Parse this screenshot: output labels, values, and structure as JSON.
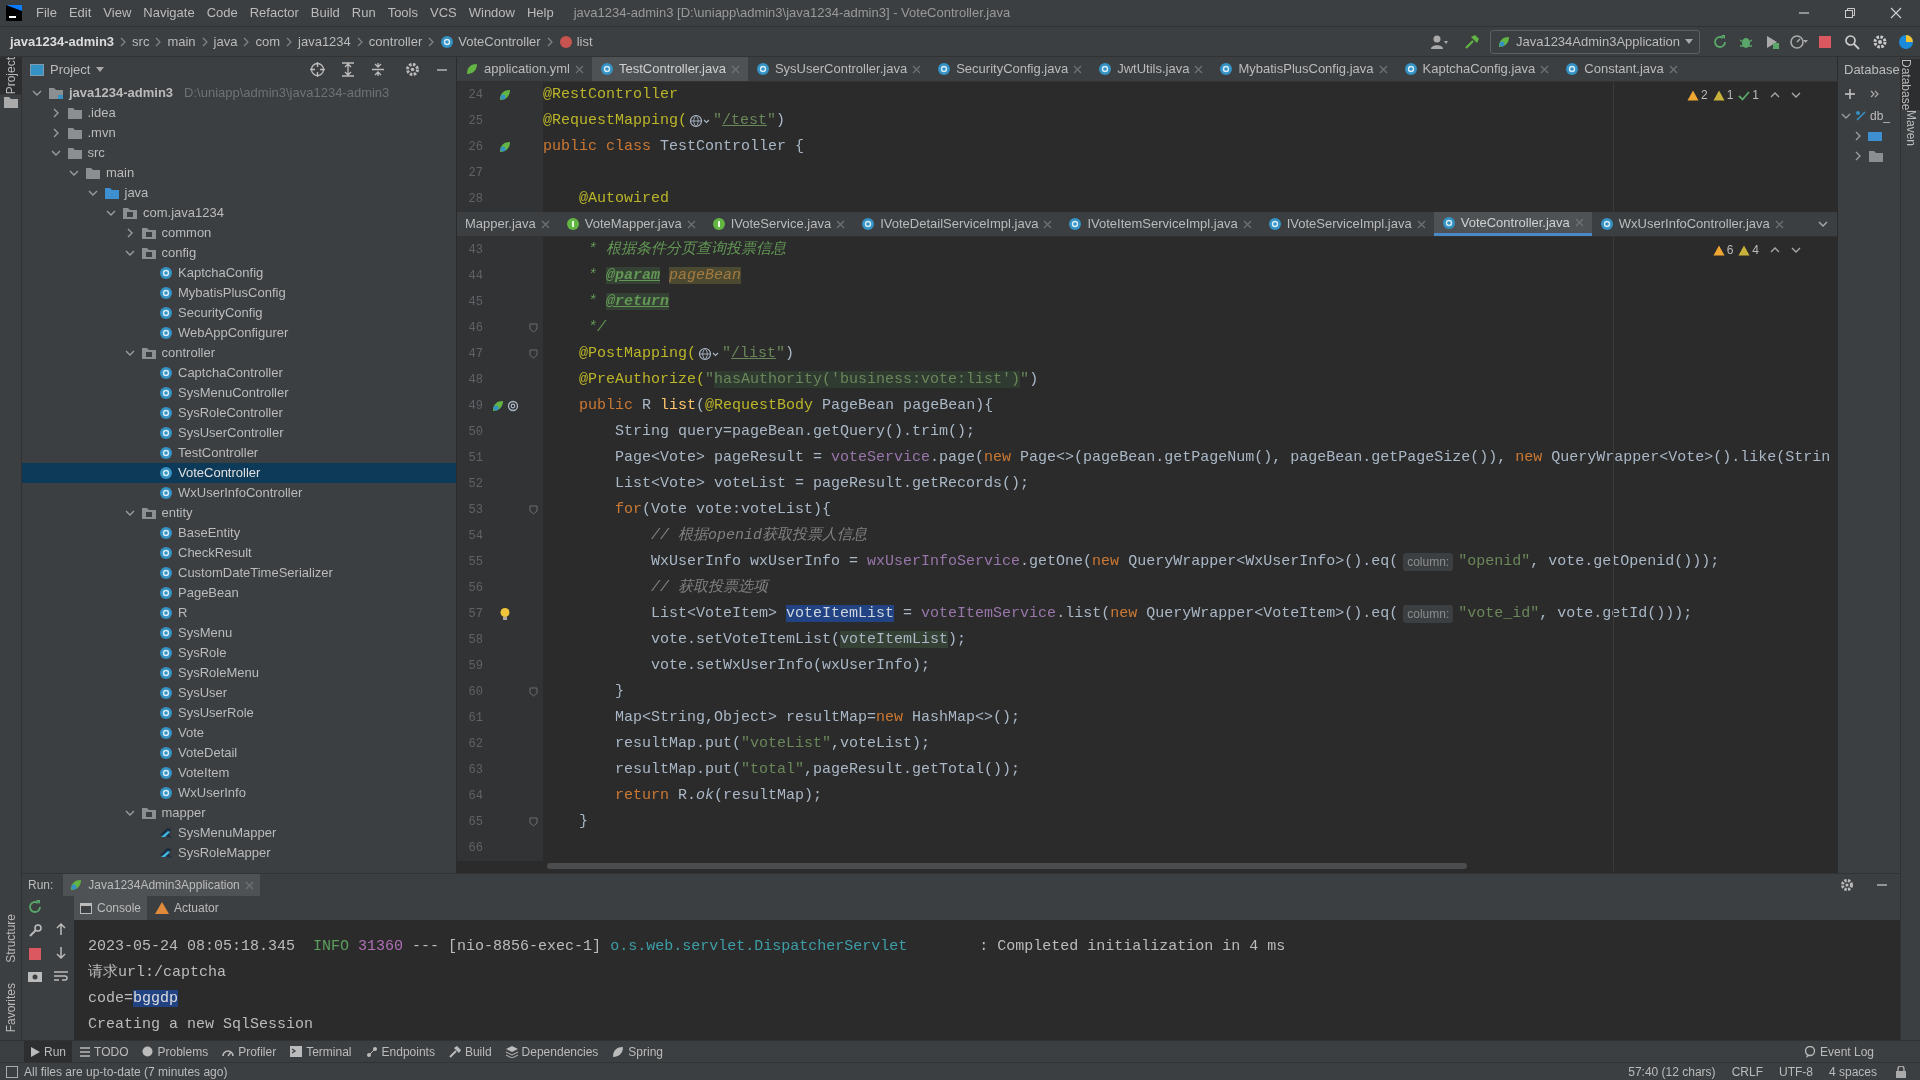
{
  "menu": [
    "File",
    "Edit",
    "View",
    "Navigate",
    "Code",
    "Refactor",
    "Build",
    "Run",
    "Tools",
    "VCS",
    "Window",
    "Help"
  ],
  "window_title": "java1234-admin3 [D:\\uniapp\\admin3\\java1234-admin3] - VoteController.java",
  "breadcrumb": [
    {
      "label": "java1234-admin3",
      "kind": "project"
    },
    {
      "label": "src",
      "kind": "folder"
    },
    {
      "label": "main",
      "kind": "folder"
    },
    {
      "label": "java",
      "kind": "folder"
    },
    {
      "label": "com",
      "kind": "folder"
    },
    {
      "label": "java1234",
      "kind": "folder"
    },
    {
      "label": "controller",
      "kind": "folder"
    },
    {
      "label": "VoteController",
      "kind": "class"
    },
    {
      "label": "list",
      "kind": "method"
    }
  ],
  "run_config": "Java1234Admin3Application",
  "project": {
    "title": "Project",
    "tree": [
      {
        "label": "java1234-admin3",
        "hint": "D:\\uniapp\\admin3\\java1234-admin3",
        "kind": "module",
        "expanded": true,
        "selected": false,
        "children": [
          {
            "label": ".idea",
            "kind": "folder",
            "expanded": false,
            "selected": false
          },
          {
            "label": ".mvn",
            "kind": "folder",
            "expanded": false,
            "selected": false
          },
          {
            "label": "src",
            "kind": "folder",
            "expanded": true,
            "selected": false,
            "children": [
              {
                "label": "main",
                "kind": "folder",
                "expanded": true,
                "selected": false,
                "children": [
                  {
                    "label": "java",
                    "kind": "source_root",
                    "expanded": true,
                    "selected": false,
                    "children": [
                      {
                        "label": "com.java1234",
                        "kind": "package",
                        "expanded": true,
                        "selected": false,
                        "children": [
                          {
                            "label": "common",
                            "kind": "package",
                            "expanded": false,
                            "selected": false
                          },
                          {
                            "label": "config",
                            "kind": "package",
                            "expanded": true,
                            "selected": false,
                            "children": [
                              {
                                "label": "KaptchaConfig",
                                "kind": "class",
                                "selected": false
                              },
                              {
                                "label": "MybatisPlusConfig",
                                "kind": "class",
                                "selected": false
                              },
                              {
                                "label": "SecurityConfig",
                                "kind": "class",
                                "selected": false
                              },
                              {
                                "label": "WebAppConfigurer",
                                "kind": "class",
                                "selected": false
                              }
                            ]
                          },
                          {
                            "label": "controller",
                            "kind": "package",
                            "expanded": true,
                            "selected": false,
                            "children": [
                              {
                                "label": "CaptchaController",
                                "kind": "class",
                                "selected": false
                              },
                              {
                                "label": "SysMenuController",
                                "kind": "class",
                                "selected": false
                              },
                              {
                                "label": "SysRoleController",
                                "kind": "class",
                                "selected": false
                              },
                              {
                                "label": "SysUserController",
                                "kind": "class",
                                "selected": false
                              },
                              {
                                "label": "TestController",
                                "kind": "class",
                                "selected": false
                              },
                              {
                                "label": "VoteController",
                                "kind": "class",
                                "selected": true
                              },
                              {
                                "label": "WxUserInfoController",
                                "kind": "class",
                                "selected": false
                              }
                            ]
                          },
                          {
                            "label": "entity",
                            "kind": "package",
                            "expanded": true,
                            "selected": false,
                            "children": [
                              {
                                "label": "BaseEntity",
                                "kind": "class",
                                "selected": false
                              },
                              {
                                "label": "CheckResult",
                                "kind": "class",
                                "selected": false
                              },
                              {
                                "label": "CustomDateTimeSerializer",
                                "kind": "class",
                                "selected": false
                              },
                              {
                                "label": "PageBean",
                                "kind": "class",
                                "selected": false
                              },
                              {
                                "label": "R",
                                "kind": "class",
                                "selected": false
                              },
                              {
                                "label": "SysMenu",
                                "kind": "class",
                                "selected": false
                              },
                              {
                                "label": "SysRole",
                                "kind": "class",
                                "selected": false
                              },
                              {
                                "label": "SysRoleMenu",
                                "kind": "class",
                                "selected": false
                              },
                              {
                                "label": "SysUser",
                                "kind": "class",
                                "selected": false
                              },
                              {
                                "label": "SysUserRole",
                                "kind": "class",
                                "selected": false
                              },
                              {
                                "label": "Vote",
                                "kind": "class",
                                "selected": false
                              },
                              {
                                "label": "VoteDetail",
                                "kind": "class",
                                "selected": false
                              },
                              {
                                "label": "VoteItem",
                                "kind": "class",
                                "selected": false
                              },
                              {
                                "label": "WxUserInfo",
                                "kind": "class",
                                "selected": false
                              }
                            ]
                          },
                          {
                            "label": "mapper",
                            "kind": "package",
                            "expanded": true,
                            "selected": false,
                            "children": [
                              {
                                "label": "SysMenuMapper",
                                "kind": "mapper",
                                "selected": false
                              },
                              {
                                "label": "SysRoleMapper",
                                "kind": "mapper",
                                "selected": false
                              }
                            ]
                          }
                        ]
                      }
                    ]
                  }
                ]
              }
            ]
          }
        ]
      }
    ]
  },
  "editor_top": {
    "focused": false,
    "tabs": [
      {
        "label": "application.yml",
        "kind": "yaml",
        "selected": false
      },
      {
        "label": "TestController.java",
        "kind": "class",
        "selected": true
      },
      {
        "label": "SysUserController.java",
        "kind": "class",
        "selected": false
      },
      {
        "label": "SecurityConfig.java",
        "kind": "class",
        "selected": false
      },
      {
        "label": "JwtUtils.java",
        "kind": "class",
        "selected": false
      },
      {
        "label": "MybatisPlusConfig.java",
        "kind": "class",
        "selected": false
      },
      {
        "label": "KaptchaConfig.java",
        "kind": "class",
        "selected": false
      },
      {
        "label": "Constant.java",
        "kind": "class",
        "selected": false
      }
    ],
    "inspections": [
      {
        "kind": "warning",
        "count": "2"
      },
      {
        "kind": "weak_warning",
        "count": "1"
      },
      {
        "kind": "ok",
        "count": "1"
      }
    ],
    "lines": [
      {
        "number": "24",
        "gutter": {
          "kind": "bean"
        },
        "segments": [
          {
            "kind": "ann",
            "text": "@RestController"
          }
        ]
      },
      {
        "number": "25",
        "segments": [
          {
            "kind": "ann",
            "text": "@RequestMapping("
          },
          {
            "kind": "globe"
          },
          {
            "kind": "str",
            "text": "\""
          },
          {
            "kind": "url",
            "text": "/test"
          },
          {
            "kind": "str",
            "text": "\""
          },
          {
            "kind": "plain",
            "text": ")"
          }
        ]
      },
      {
        "number": "26",
        "gutter": {
          "kind": "bean"
        },
        "segments": [
          {
            "kind": "kw",
            "text": "public class "
          },
          {
            "kind": "plain",
            "text": "TestController {"
          }
        ]
      },
      {
        "number": "27"
      },
      {
        "number": "28",
        "segments": [
          {
            "kind": "ann",
            "text": "    @Autowired"
          }
        ]
      }
    ]
  },
  "editor_bottom": {
    "focused": true,
    "tabs": [
      {
        "label": "Mapper.java",
        "kind": "none",
        "selected": false
      },
      {
        "label": "VoteMapper.java",
        "kind": "interface",
        "selected": false
      },
      {
        "label": "IVoteService.java",
        "kind": "interface",
        "selected": false
      },
      {
        "label": "IVoteDetailServiceImpl.java",
        "kind": "class",
        "selected": false
      },
      {
        "label": "IVoteItemServiceImpl.java",
        "kind": "class",
        "selected": false
      },
      {
        "label": "IVoteServiceImpl.java",
        "kind": "class",
        "selected": false
      },
      {
        "label": "VoteController.java",
        "kind": "class",
        "selected": true
      },
      {
        "label": "WxUserInfoController.java",
        "kind": "class",
        "selected": false
      }
    ],
    "inspections": [
      {
        "kind": "warning",
        "count": "6"
      },
      {
        "kind": "weak_warning",
        "count": "4"
      }
    ],
    "lines": [
      {
        "number": "43",
        "segments": [
          {
            "kind": "doc",
            "text": "     * 根据条件分页查询投票信息"
          }
        ]
      },
      {
        "number": "44",
        "segments": [
          {
            "kind": "doc",
            "text": "     * "
          },
          {
            "kind": "doctag",
            "text": "@param"
          },
          {
            "kind": "param",
            "text": "pageBean"
          }
        ]
      },
      {
        "number": "45",
        "segments": [
          {
            "kind": "doc",
            "text": "     * "
          },
          {
            "kind": "doctag",
            "text": "@return"
          }
        ]
      },
      {
        "number": "46",
        "gutter": {
          "kind": "fold"
        },
        "segments": [
          {
            "kind": "doc",
            "text": "     */"
          }
        ]
      },
      {
        "number": "47",
        "gutter": {
          "kind": "fold"
        },
        "segments": [
          {
            "kind": "ann",
            "text": "    @PostMapping("
          },
          {
            "kind": "globe"
          },
          {
            "kind": "str",
            "text": "\""
          },
          {
            "kind": "url",
            "text": "/list"
          },
          {
            "kind": "str",
            "text": "\""
          },
          {
            "kind": "plain",
            "text": ")"
          }
        ]
      },
      {
        "number": "48",
        "segments": [
          {
            "kind": "ann",
            "text": "    @PreAuthorize("
          },
          {
            "kind": "str",
            "text": "\""
          },
          {
            "kind": "inject",
            "text": "hasAuthority('business:vote:list')"
          },
          {
            "kind": "str",
            "text": "\""
          },
          {
            "kind": "plain",
            "text": ")"
          }
        ]
      },
      {
        "number": "49",
        "gutter": {
          "kind": "bean_at"
        },
        "segments": [
          {
            "kind": "kw",
            "text": "    public "
          },
          {
            "kind": "plain",
            "text": "R "
          },
          {
            "kind": "method",
            "text": "list"
          },
          {
            "kind": "plain",
            "text": "("
          },
          {
            "kind": "ann",
            "text": "@RequestBody"
          },
          {
            "kind": "plain",
            "text": " PageBean pageBean){"
          }
        ]
      },
      {
        "number": "50",
        "segments": [
          {
            "kind": "plain",
            "text": "        String query=pageBean.getQuery().trim();"
          }
        ]
      },
      {
        "number": "51",
        "segments": [
          {
            "kind": "plain",
            "text": "        Page<Vote> pageResult = "
          },
          {
            "kind": "field",
            "text": "voteService"
          },
          {
            "kind": "plain",
            "text": ".page("
          },
          {
            "kind": "kw",
            "text": "new "
          },
          {
            "kind": "plain",
            "text": "Page<>(pageBean.getPageNum(), pageBean.getPageSize()), "
          },
          {
            "kind": "kw",
            "text": "new "
          },
          {
            "kind": "plain",
            "text": "QueryWrapper<Vote>().like(Strin"
          }
        ]
      },
      {
        "number": "52",
        "segments": [
          {
            "kind": "plain",
            "text": "        List<Vote> voteList = pageResult.getRecords();"
          }
        ]
      },
      {
        "number": "53",
        "gutter": {
          "kind": "fold"
        },
        "segments": [
          {
            "kind": "kw",
            "text": "        for"
          },
          {
            "kind": "plain",
            "text": "(Vote vote:voteList){"
          }
        ]
      },
      {
        "number": "54",
        "segments": [
          {
            "kind": "cmt",
            "text": "            // 根据openid获取投票人信息"
          }
        ]
      },
      {
        "number": "55",
        "segments": [
          {
            "kind": "plain",
            "text": "            WxUserInfo wxUserInfo = "
          },
          {
            "kind": "field",
            "text": "wxUserInfoService"
          },
          {
            "kind": "plain",
            "text": ".getOne("
          },
          {
            "kind": "kw",
            "text": "new "
          },
          {
            "kind": "plain",
            "text": "QueryWrapper<WxUserInfo>().eq("
          },
          {
            "kind": "hint",
            "text": "column:"
          },
          {
            "kind": "str",
            "text": "\"openid\""
          },
          {
            "kind": "plain",
            "text": ", vote.getOpenid()));"
          }
        ]
      },
      {
        "number": "56",
        "segments": [
          {
            "kind": "cmt",
            "text": "            // 获取投票选项"
          }
        ]
      },
      {
        "number": "57",
        "gutter": {
          "kind": "bulb"
        },
        "segments": [
          {
            "kind": "plain",
            "text": "            List<VoteItem> "
          },
          {
            "kind": "sel",
            "text": "voteItemList"
          },
          {
            "kind": "plain",
            "text": " = "
          },
          {
            "kind": "field",
            "text": "voteItemService"
          },
          {
            "kind": "plain",
            "text": ".list("
          },
          {
            "kind": "kw",
            "text": "new "
          },
          {
            "kind": "plain",
            "text": "QueryWrapper<VoteItem>().eq("
          },
          {
            "kind": "hint",
            "text": "column:"
          },
          {
            "kind": "str",
            "text": "\"vote_id\""
          },
          {
            "kind": "plain",
            "text": ", vote.getId()));"
          }
        ]
      },
      {
        "number": "58",
        "segments": [
          {
            "kind": "plain",
            "text": "            vote.setVoteItemList("
          },
          {
            "kind": "ref",
            "text": "voteItemList"
          },
          {
            "kind": "plain",
            "text": ");"
          }
        ]
      },
      {
        "number": "59",
        "segments": [
          {
            "kind": "plain",
            "text": "            vote.setWxUserInfo(wxUserInfo);"
          }
        ]
      },
      {
        "number": "60",
        "gutter": {
          "kind": "fold"
        },
        "segments": [
          {
            "kind": "plain",
            "text": "        }"
          }
        ]
      },
      {
        "number": "61",
        "segments": [
          {
            "kind": "plain",
            "text": "        Map<String,Object> resultMap="
          },
          {
            "kind": "kw",
            "text": "new "
          },
          {
            "kind": "plain",
            "text": "HashMap<>();"
          }
        ]
      },
      {
        "number": "62",
        "segments": [
          {
            "kind": "plain",
            "text": "        resultMap.put("
          },
          {
            "kind": "str",
            "text": "\"voteList\""
          },
          {
            "kind": "plain",
            "text": ",voteList);"
          }
        ]
      },
      {
        "number": "63",
        "segments": [
          {
            "kind": "plain",
            "text": "        resultMap.put("
          },
          {
            "kind": "str",
            "text": "\"total\""
          },
          {
            "kind": "plain",
            "text": ",pageResult.getTotal());"
          }
        ]
      },
      {
        "number": "64",
        "segments": [
          {
            "kind": "kw",
            "text": "        return "
          },
          {
            "kind": "plain",
            "text": "R."
          },
          {
            "kind": "static",
            "text": "ok"
          },
          {
            "kind": "plain",
            "text": "(resultMap);"
          }
        ]
      },
      {
        "number": "65",
        "gutter": {
          "kind": "fold"
        },
        "segments": [
          {
            "kind": "plain",
            "text": "    }"
          }
        ]
      },
      {
        "number": "66"
      }
    ]
  },
  "database": {
    "title": "Database",
    "items": [
      {
        "label": "db_",
        "expanded": true
      }
    ]
  },
  "left_strip": [
    "Project",
    "Structure",
    "Favorites"
  ],
  "right_strip": [
    "Database",
    "Maven"
  ],
  "run": {
    "label": "Run:",
    "tab": "Java1234Admin3Application",
    "subtabs": [
      {
        "label": "Console",
        "selected": true
      },
      {
        "label": "Actuator",
        "selected": false
      }
    ],
    "console": [
      [
        {
          "kind": "plain",
          "text": "2023-05-24 08:05:18.345  "
        },
        {
          "kind": "info",
          "text": "INFO"
        },
        {
          "kind": "pid",
          "text": " 31360"
        },
        {
          "kind": "plain",
          "text": " --- [nio-8856-exec-1] "
        },
        {
          "kind": "logger",
          "text": "o.s.web.servlet.DispatcherServlet"
        },
        {
          "kind": "plain",
          "text": "        : Completed initialization in 4 ms"
        }
      ],
      [
        {
          "kind": "plain",
          "text": "请求url:/captcha"
        }
      ],
      [
        {
          "kind": "plain",
          "text": "code="
        },
        {
          "kind": "sel",
          "text": "bggdp"
        }
      ],
      [
        {
          "kind": "plain",
          "text": "Creating a new SqlSession"
        }
      ]
    ]
  },
  "tool_windows": [
    {
      "label": "Run",
      "selected": true
    },
    {
      "label": "TODO",
      "selected": false
    },
    {
      "label": "Problems",
      "selected": false
    },
    {
      "label": "Profiler",
      "selected": false
    },
    {
      "label": "Terminal",
      "selected": false
    },
    {
      "label": "Endpoints",
      "selected": false
    },
    {
      "label": "Build",
      "selected": false
    },
    {
      "label": "Dependencies",
      "selected": false
    },
    {
      "label": "Spring",
      "selected": false
    }
  ],
  "event_log": "Event Log",
  "status_bar": {
    "message": "All files are up-to-date (7 minutes ago)",
    "items": [
      "57:40 (12 chars)",
      "CRLF",
      "UTF-8",
      "4 spaces"
    ]
  }
}
